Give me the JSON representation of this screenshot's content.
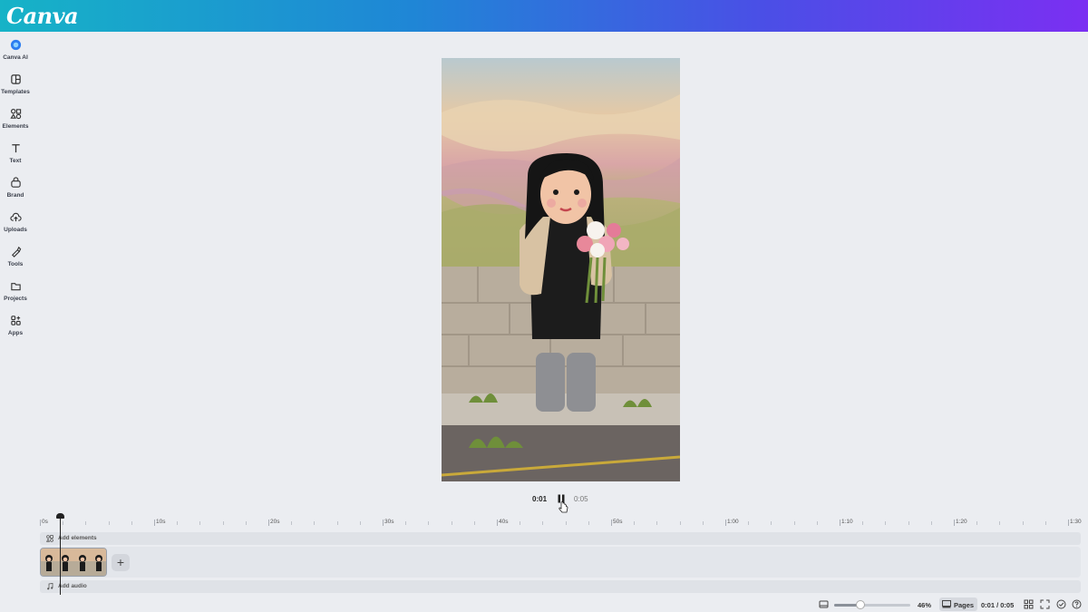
{
  "app": {
    "logo": "Canva"
  },
  "sidebar": {
    "items": [
      {
        "label": "Canva AI",
        "icon": "canva-ai-icon"
      },
      {
        "label": "Templates",
        "icon": "templates-icon"
      },
      {
        "label": "Elements",
        "icon": "elements-icon"
      },
      {
        "label": "Text",
        "icon": "text-icon"
      },
      {
        "label": "Brand",
        "icon": "brand-icon"
      },
      {
        "label": "Uploads",
        "icon": "uploads-icon"
      },
      {
        "label": "Tools",
        "icon": "tools-icon"
      },
      {
        "label": "Projects",
        "icon": "folder-icon"
      },
      {
        "label": "Apps",
        "icon": "apps-icon"
      }
    ]
  },
  "player": {
    "current": "0:01",
    "total": "0:05"
  },
  "timeline": {
    "ticks": [
      "0s",
      "10s",
      "20s",
      "30s",
      "40s",
      "50s",
      "1:00",
      "1:10",
      "1:20",
      "1:30"
    ],
    "add_elements": "Add elements",
    "add_audio": "Add audio"
  },
  "footer": {
    "zoom": "46%",
    "zoom_level": 0.46,
    "pages_label": "Pages",
    "time": "0:01 / 0:05"
  },
  "colors": {
    "header_start": "#16b3c7",
    "header_end": "#7b2ff2",
    "background": "#ebedf1"
  }
}
